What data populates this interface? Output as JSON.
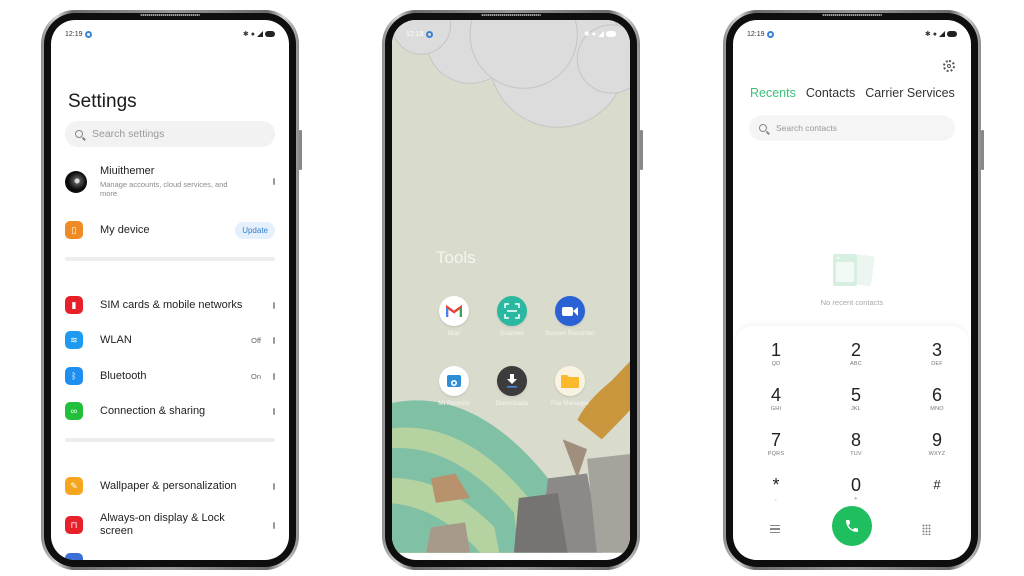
{
  "status_bar": {
    "time": "12:19",
    "icons": [
      "bluetooth-icon",
      "alarm-icon",
      "signal-icon",
      "battery-icon"
    ]
  },
  "settings": {
    "title": "Settings",
    "search_placeholder": "Search settings",
    "account": {
      "name": "Miuithemer",
      "subtitle": "Manage accounts, cloud services, and more"
    },
    "my_device": {
      "label": "My device",
      "badge": "Update"
    },
    "group1": [
      {
        "label": "SIM cards & mobile networks",
        "value": "",
        "icon": "sim-icon",
        "color": "#e8202a"
      },
      {
        "label": "WLAN",
        "value": "Off",
        "icon": "wifi-icon",
        "color": "#1e9bf0"
      },
      {
        "label": "Bluetooth",
        "value": "On",
        "icon": "bluetooth-icon",
        "color": "#1e8ef0"
      },
      {
        "label": "Connection & sharing",
        "value": "",
        "icon": "connection-icon",
        "color": "#22c03a"
      }
    ],
    "group2": [
      {
        "label": "Wallpaper & personalization",
        "icon": "wallpaper-icon",
        "color": "#f5a51e"
      },
      {
        "label": "Always-on display & Lock screen",
        "icon": "lock-icon",
        "color": "#e8202a"
      }
    ],
    "device_icon_color": "#f08a24"
  },
  "home": {
    "folder_title": "Tools",
    "apps": [
      {
        "label": "Mail",
        "icon": "gmail-icon"
      },
      {
        "label": "Scanner",
        "icon": "scanner-icon"
      },
      {
        "label": "Screen Recorder",
        "icon": "screen-recorder-icon"
      },
      {
        "label": "Mi Remote",
        "icon": "mi-remote-icon"
      },
      {
        "label": "Downloads",
        "icon": "downloads-icon"
      },
      {
        "label": "File Manager",
        "icon": "file-manager-icon"
      }
    ]
  },
  "dialer": {
    "tabs": [
      "Recents",
      "Contacts",
      "Carrier Services"
    ],
    "active_tab": "Recents",
    "search_placeholder": "Search contacts",
    "empty_text": "No recent contacts",
    "accent": "#3bbf7c",
    "call_color": "#1fbe5e",
    "keys": [
      {
        "num": "1",
        "sub": "QD"
      },
      {
        "num": "2",
        "sub": "ABC"
      },
      {
        "num": "3",
        "sub": "DEF"
      },
      {
        "num": "4",
        "sub": "GHI"
      },
      {
        "num": "5",
        "sub": "JKL"
      },
      {
        "num": "6",
        "sub": "MNO"
      },
      {
        "num": "7",
        "sub": "PQRS"
      },
      {
        "num": "8",
        "sub": "TUV"
      },
      {
        "num": "9",
        "sub": "WXYZ"
      },
      {
        "num": "*",
        "sub": ","
      },
      {
        "num": "0",
        "sub": "+"
      },
      {
        "num": "#",
        "sub": ""
      }
    ]
  }
}
